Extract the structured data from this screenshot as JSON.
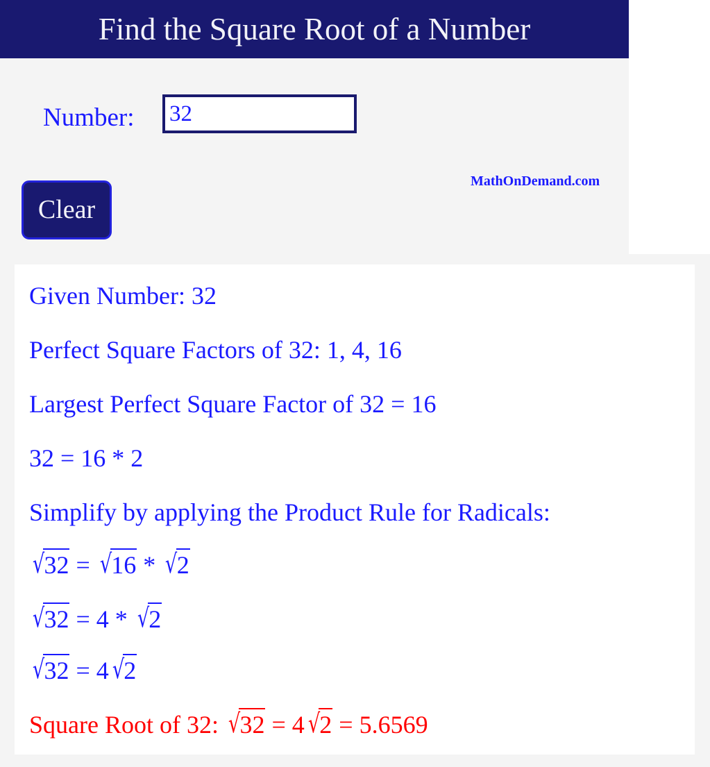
{
  "header": {
    "title": "Find the Square Root of a Number",
    "background_color": "#191970",
    "text_color": "#f2f2f8"
  },
  "form": {
    "number_label": "Number:",
    "number_value": "32",
    "number_placeholder": "",
    "clear_label": "Clear",
    "brand": "MathOnDemand.com",
    "accent_color": "#1a1aff",
    "navy_color": "#191970"
  },
  "results": {
    "text_color": "#1a1aff",
    "final_color": "#ff0000",
    "lines": [
      {
        "id": "given-number",
        "text": "Given Number: 32"
      },
      {
        "id": "perfect-square-factors",
        "text": "Perfect Square Factors of 32: 1, 4, 16"
      },
      {
        "id": "largest-perfect-square-factor",
        "text": "Largest Perfect Square Factor of 32 = 16"
      },
      {
        "id": "factorization",
        "text": "32 = 16 * 2"
      },
      {
        "id": "product-rule-heading",
        "text": "Simplify by applying the Product Rule for Radicals:"
      }
    ],
    "equation_1": {
      "lhs_radicand": "32",
      "eq": " = ",
      "rhs_radicand_a": "16",
      "times": " * ",
      "rhs_radicand_b": "2"
    },
    "equation_2": {
      "lhs_radicand": "32",
      "eq": " = ",
      "coefficient": "4",
      "times": " * ",
      "rhs_radicand": "2"
    },
    "equation_3": {
      "lhs_radicand": "32",
      "eq": " = ",
      "coefficient": "4",
      "rhs_radicand": "2"
    },
    "final": {
      "prefix": "Square Root of 32: ",
      "lhs_radicand": "32",
      "eq1": " = ",
      "coefficient": "4",
      "rhs_radicand": "2",
      "eq2": " = ",
      "decimal": "5.6569"
    },
    "radical_glyph": "√"
  }
}
